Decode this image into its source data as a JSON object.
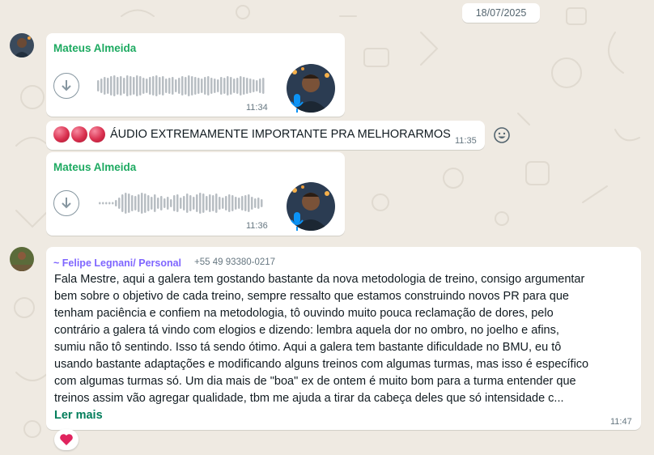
{
  "date_chip": "18/07/2025",
  "messages": [
    {
      "sender": "Mateus Almeida",
      "type": "voice",
      "time": "11:34"
    },
    {
      "type": "text",
      "text": "ÁUDIO EXTREMAMENTE IMPORTANTE PRA MELHORARMOS",
      "time": "11:35",
      "prefix_emoji": "red-circle-x3"
    },
    {
      "sender": "Mateus Almeida",
      "type": "voice",
      "time": "11:36"
    },
    {
      "sender": "~ Felipe Legnani/ Personal",
      "phone": "+55 49 93380-0217",
      "type": "text",
      "lines": [
        "Fala Mestre, aqui a galera tem gostando bastante da nova metodologia de treino, consigo argumentar",
        "bem sobre o objetivo de cada treino, sempre ressalto que estamos construindo novos PR para que",
        "tenham paciência e confiem na metodologia,  tô ouvindo muito pouca reclamação de dores, pelo",
        "contrário a galera tá vindo com elogios e dizendo: lembra aquela dor no ombro, no joelho e afins,",
        "sumiu não tô sentindo. Isso tá sendo ótimo. Aqui a galera tem bastante dificuldade no BMU, eu tô",
        "usando bastante adaptações e modificando alguns treinos com algumas turmas, mas isso é específico",
        "com algumas turmas só. Um dia mais de \"boa\" ex de ontem é muito bom para a turma entender que",
        "treinos assim vão agregar qualidade, tbm me ajuda a tirar da cabeça deles que só intensidade c..."
      ],
      "read_more": "Ler mais",
      "time": "11:47",
      "reaction": "heart"
    }
  ],
  "colors": {
    "background": "#efeae2",
    "sender_green": "#1daa61",
    "group_sender_purple": "#7f66ff",
    "read_more_green": "#027e5b",
    "mic_blue": "#0b93f6"
  }
}
